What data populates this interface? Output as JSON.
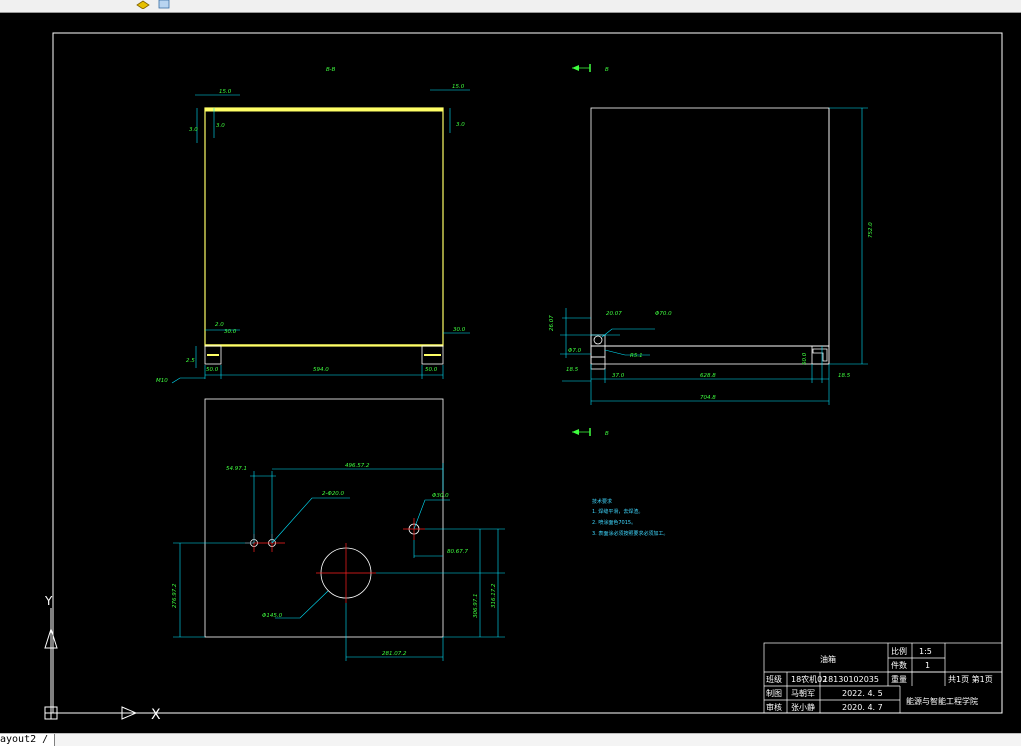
{
  "layout_tab": "ayout2 /",
  "view_labels": {
    "section": "B-B",
    "arrow_top": "B",
    "arrow_bottom": "B"
  },
  "front_view_dims": {
    "top_left": "15.0",
    "top_right": "15.0",
    "left_v1": "3.0",
    "left_v2": "3.0",
    "right_v": "3.0",
    "bl_2": "2.0",
    "bl_30": "30.0",
    "br_30": "30.0",
    "left_25": "2.5",
    "bottom_50l": "50.0",
    "bottom_594": "594.0",
    "bottom_50r": "50.0",
    "m_label": "M10"
  },
  "side_view_dims": {
    "height": "752.0",
    "left_26": "26.07",
    "d_top": "20.07",
    "dia": "Φ70.0",
    "r": "R5.1",
    "h47": "Φ7.0",
    "left_185": "18.5",
    "w37": "37.0",
    "w628": "628.8",
    "w704": "704.8",
    "h50": "50.0",
    "right_185": "18.5"
  },
  "bottom_view_dims": {
    "d1": "54.97.1",
    "d2": "496.57.2",
    "holes2": "2-Φ20.0",
    "hole_right": "Φ30.0",
    "d_right": "80.67.7",
    "d_left_h": "276.97.2",
    "d_center": "Φ145.0",
    "d_mid": "306.97.1",
    "d_far": "316.17.2",
    "d_bottom": "281.07.2"
  },
  "tech_notes": {
    "title": "技术要求",
    "items": [
      "1. 焊缝平滑，去焊渣。",
      "2. 喷涂面色7015。",
      "3. 表面涂必须按照要求必须加工。"
    ]
  },
  "title_block": {
    "name": "油箱",
    "scale_label": "比例",
    "scale_value": "1:5",
    "qty_label": "件数",
    "qty_value": "1",
    "weight_label": "重量",
    "sheet": "共1页 第1页",
    "class_label": "班级",
    "class_value": "18农机02",
    "student_id": "18130102035",
    "drawn_label": "制图",
    "drawn_name": "马朝军",
    "drawn_date": "2022. 4. 5",
    "check_label": "审核",
    "check_name": "张小静",
    "check_date": "2020. 4. 7",
    "school": "能源与智能工程学院"
  },
  "ucs": {
    "y": "Y",
    "x": "X"
  },
  "colors": {
    "canvas": "#000000",
    "frame": "#ffffff",
    "outline_yellow": "#ffff66",
    "dimension_cyan": "#00e5ff",
    "dimension_text": "#3fff3f",
    "centerline": "#ff2020"
  }
}
